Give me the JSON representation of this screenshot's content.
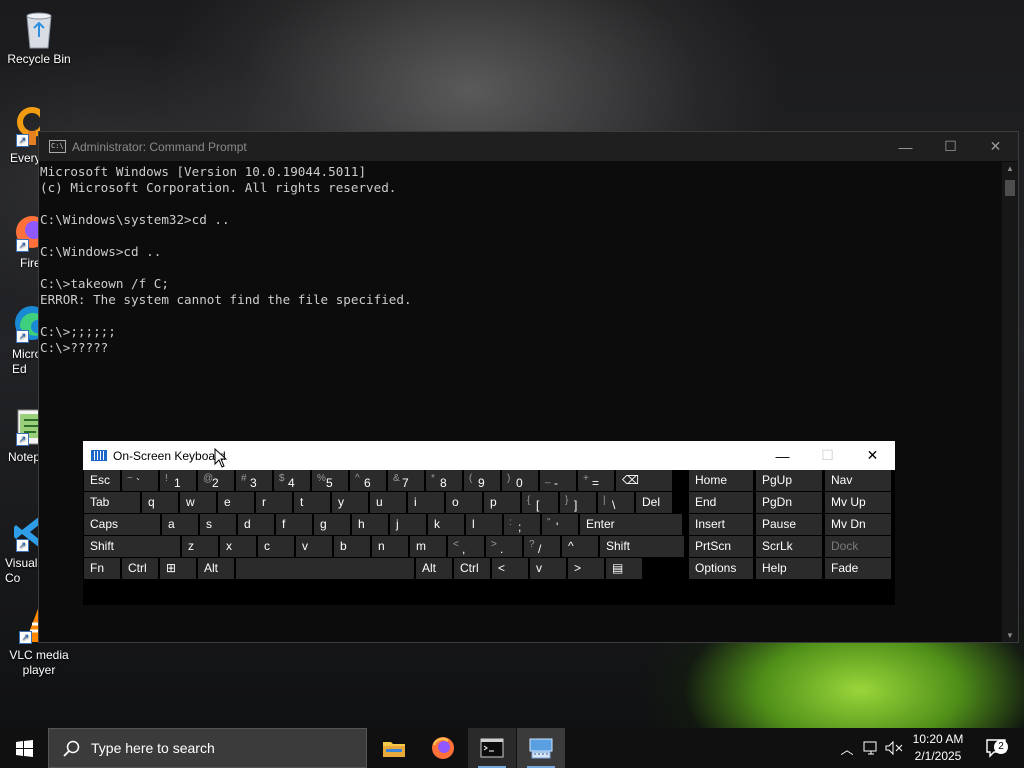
{
  "desktop": {
    "icons": [
      {
        "label": "Recycle Bin",
        "icon": "recycle-bin-icon"
      },
      {
        "label": "Every",
        "icon": "everything-icon"
      },
      {
        "label": "Fire",
        "icon": "firefox-icon"
      },
      {
        "label": "Micro\nEd",
        "icon": "edge-icon"
      },
      {
        "label": "Notep",
        "icon": "notepad-icon"
      },
      {
        "label": "Visual\nCo",
        "icon": "vscode-icon"
      },
      {
        "label": "VLC media\nplayer",
        "icon": "vlc-icon"
      }
    ]
  },
  "cmd": {
    "title": "Administrator: Command Prompt",
    "lines": [
      "Microsoft Windows [Version 10.0.19044.5011]",
      "(c) Microsoft Corporation. All rights reserved.",
      "",
      "C:\\Windows\\system32>cd ..",
      "",
      "C:\\Windows>cd ..",
      "",
      "C:\\>takeown /f C;",
      "ERROR: The system cannot find the file specified.",
      "",
      "C:\\>;;;;;;",
      "C:\\>?????"
    ]
  },
  "osk": {
    "title": "On-Screen Keyboard",
    "rows": [
      [
        {
          "label": "Esc"
        },
        {
          "label": "`",
          "shift": "~"
        },
        {
          "label": "1",
          "shift": "!"
        },
        {
          "label": "2",
          "shift": "@"
        },
        {
          "label": "3",
          "shift": "#"
        },
        {
          "label": "4",
          "shift": "$"
        },
        {
          "label": "5",
          "shift": "%"
        },
        {
          "label": "6",
          "shift": "^"
        },
        {
          "label": "7",
          "shift": "&"
        },
        {
          "label": "8",
          "shift": "*"
        },
        {
          "label": "9",
          "shift": "("
        },
        {
          "label": "0",
          "shift": ")"
        },
        {
          "label": "-",
          "shift": "_"
        },
        {
          "label": "=",
          "shift": "+"
        },
        {
          "label": "⌫"
        }
      ],
      [
        {
          "label": "Tab"
        },
        {
          "label": "q"
        },
        {
          "label": "w"
        },
        {
          "label": "e"
        },
        {
          "label": "r"
        },
        {
          "label": "t"
        },
        {
          "label": "y"
        },
        {
          "label": "u"
        },
        {
          "label": "i"
        },
        {
          "label": "o"
        },
        {
          "label": "p"
        },
        {
          "label": "[",
          "shift": "{"
        },
        {
          "label": "]",
          "shift": "}"
        },
        {
          "label": "\\",
          "shift": "|"
        },
        {
          "label": "Del"
        }
      ],
      [
        {
          "label": "Caps"
        },
        {
          "label": "a"
        },
        {
          "label": "s"
        },
        {
          "label": "d"
        },
        {
          "label": "f"
        },
        {
          "label": "g"
        },
        {
          "label": "h"
        },
        {
          "label": "j"
        },
        {
          "label": "k"
        },
        {
          "label": "l"
        },
        {
          "label": ";",
          "shift": ":"
        },
        {
          "label": "'",
          "shift": "\""
        },
        {
          "label": "Enter"
        }
      ],
      [
        {
          "label": "Shift"
        },
        {
          "label": "z"
        },
        {
          "label": "x"
        },
        {
          "label": "c"
        },
        {
          "label": "v"
        },
        {
          "label": "b"
        },
        {
          "label": "n"
        },
        {
          "label": "m"
        },
        {
          "label": ",",
          "shift": "<"
        },
        {
          "label": ".",
          "shift": ">"
        },
        {
          "label": "/",
          "shift": "?"
        },
        {
          "label": "^"
        },
        {
          "label": "Shift"
        }
      ],
      [
        {
          "label": "Fn"
        },
        {
          "label": "Ctrl"
        },
        {
          "label": "⊞"
        },
        {
          "label": "Alt"
        },
        {
          "label": ""
        },
        {
          "label": "Alt"
        },
        {
          "label": "Ctrl"
        },
        {
          "label": "<"
        },
        {
          "label": "v"
        },
        {
          "label": ">"
        },
        {
          "label": "▤"
        }
      ]
    ],
    "nav": [
      [
        "Home",
        "PgUp",
        "Nav"
      ],
      [
        "End",
        "PgDn",
        "Mv Up"
      ],
      [
        "Insert",
        "Pause",
        "Mv Dn"
      ],
      [
        "PrtScn",
        "ScrLk",
        "Dock"
      ],
      [
        "Options",
        "Help",
        "Fade"
      ]
    ]
  },
  "taskbar": {
    "search_placeholder": "Type here to search",
    "apps": [
      "file-explorer-icon",
      "firefox-icon",
      "command-prompt-icon",
      "on-screen-keyboard-icon"
    ],
    "time": "10:20 AM",
    "date": "2/1/2025",
    "notification_count": "2"
  }
}
